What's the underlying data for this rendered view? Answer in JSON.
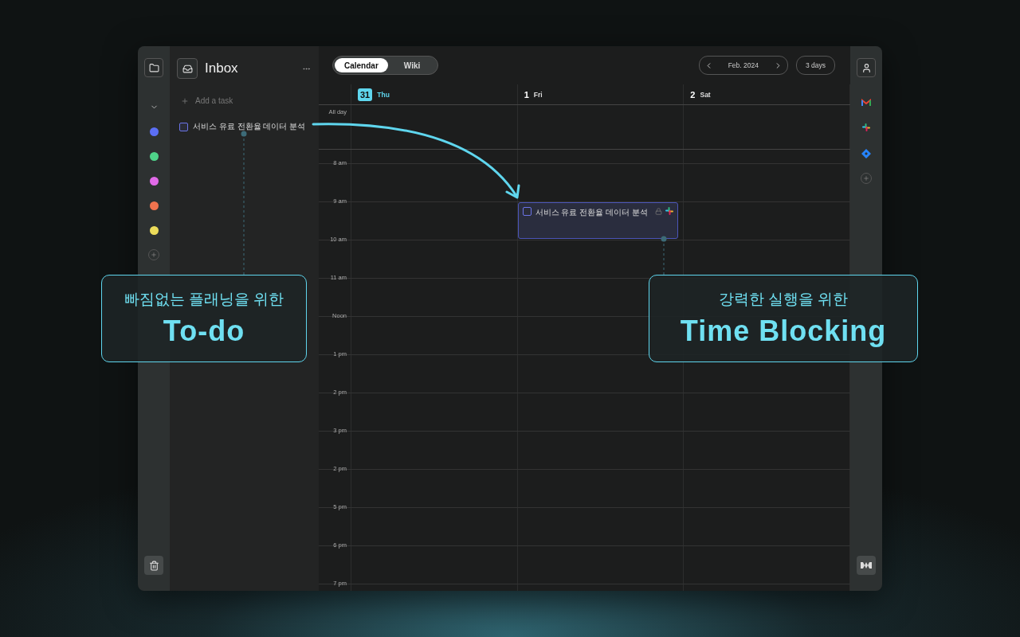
{
  "sidebar": {
    "projects": [
      {
        "color": "#5b6ff5"
      },
      {
        "color": "#4fd48a"
      },
      {
        "color": "#e06ae8"
      },
      {
        "color": "#f0734e"
      },
      {
        "color": "#ecdc5a"
      }
    ]
  },
  "inbox": {
    "title": "Inbox",
    "add_placeholder": "Add a task",
    "tasks": [
      {
        "title": "서비스 유료 전환율 데이터 분석",
        "checked": false
      }
    ]
  },
  "view_tabs": [
    {
      "label": "Calendar",
      "selected": true
    },
    {
      "label": "Wiki",
      "selected": false
    }
  ],
  "month": "Feb. 2024",
  "range": "3 days",
  "days": [
    {
      "number": "31",
      "name": "Thu",
      "today": true
    },
    {
      "number": "1",
      "name": "Fri",
      "today": false,
      "events": [
        {
          "title": "서비스 유료 전환율 데이터 분석",
          "checked": false
        }
      ]
    },
    {
      "number": "2",
      "name": "Sat",
      "today": false
    }
  ],
  "all_day_label": "All day",
  "hours": [
    "8 am",
    "9 am",
    "10 am",
    "11 am",
    "Noon",
    "1 pm",
    "2 pm",
    "3 pm",
    "2 pm",
    "5 pm",
    "6 pm",
    "7 pm"
  ],
  "callouts": [
    {
      "subtitle": "빠짐없는 플래닝을 위한",
      "title": "To-do"
    },
    {
      "subtitle": "강력한 실행을 위한",
      "title": "Time Blocking"
    }
  ]
}
